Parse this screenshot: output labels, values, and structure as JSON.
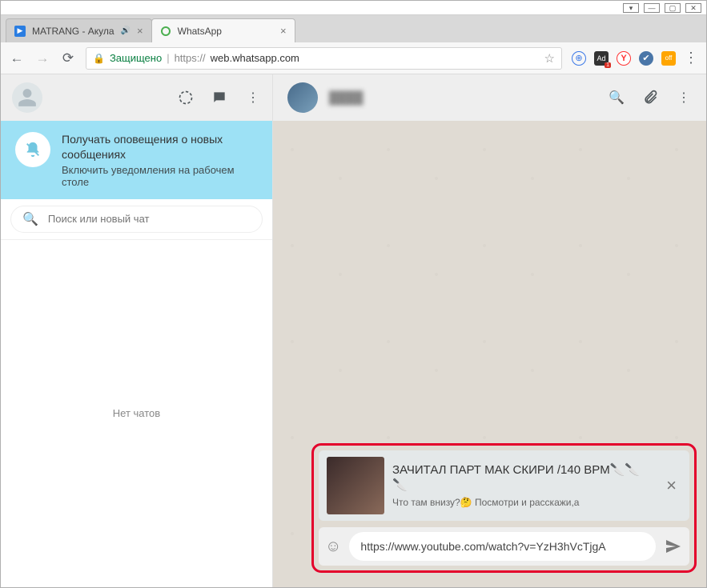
{
  "os_buttons": {
    "dropdown": "▾",
    "min": "—",
    "max": "▢",
    "close": "✕"
  },
  "tabs": [
    {
      "label": "MATRANG - Акула",
      "audio": "🔊",
      "favicon": "▶"
    },
    {
      "label": "WhatsApp",
      "favicon": "wa"
    }
  ],
  "addr": {
    "secure_label": "Защищено",
    "proto": "https://",
    "host": "web.whatsapp.com"
  },
  "ext": {
    "adblock_badge": "1",
    "saver": "off"
  },
  "wa": {
    "notif_title": "Получать оповещения о новых сообщениях",
    "notif_action": "Включить уведомления на рабочем столе",
    "search_placeholder": "Поиск или новый чат",
    "no_chats": "Нет чатов",
    "chat_name": "████",
    "preview": {
      "title": "ЗАЧИТАЛ ПАРТ МАК СКИРИ /140 BPM🔪🔪🔪",
      "subtitle": "Что там внизу?🤔 Посмотри и расскажи,а"
    },
    "input_value": "https://www.youtube.com/watch?v=YzH3hVcTjgA"
  }
}
